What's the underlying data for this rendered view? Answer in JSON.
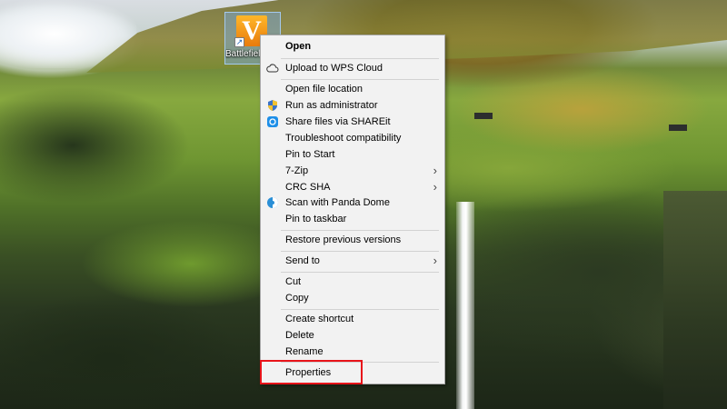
{
  "desktop": {
    "shortcut": {
      "label": "Battlefield",
      "logo_letter": "V"
    }
  },
  "context_menu": {
    "items": [
      {
        "label": "Open",
        "bold": true
      },
      {
        "label": "Upload to WPS Cloud",
        "icon": "cloud-icon"
      },
      {
        "label": "Open file location"
      },
      {
        "label": "Run as administrator",
        "icon": "uac-shield-icon"
      },
      {
        "label": "Share files via SHAREit",
        "icon": "shareit-icon"
      },
      {
        "label": "Troubleshoot compatibility"
      },
      {
        "label": "Pin to Start"
      },
      {
        "label": "7-Zip",
        "submenu": true
      },
      {
        "label": "CRC SHA",
        "submenu": true
      },
      {
        "label": "Scan with Panda Dome",
        "icon": "panda-dome-icon"
      },
      {
        "label": "Pin to taskbar"
      },
      {
        "label": "Restore previous versions"
      },
      {
        "label": "Send to",
        "submenu": true
      },
      {
        "label": "Cut"
      },
      {
        "label": "Copy"
      },
      {
        "label": "Create shortcut"
      },
      {
        "label": "Delete"
      },
      {
        "label": "Rename"
      },
      {
        "label": "Properties"
      }
    ]
  },
  "highlight_color": "#e8141a"
}
